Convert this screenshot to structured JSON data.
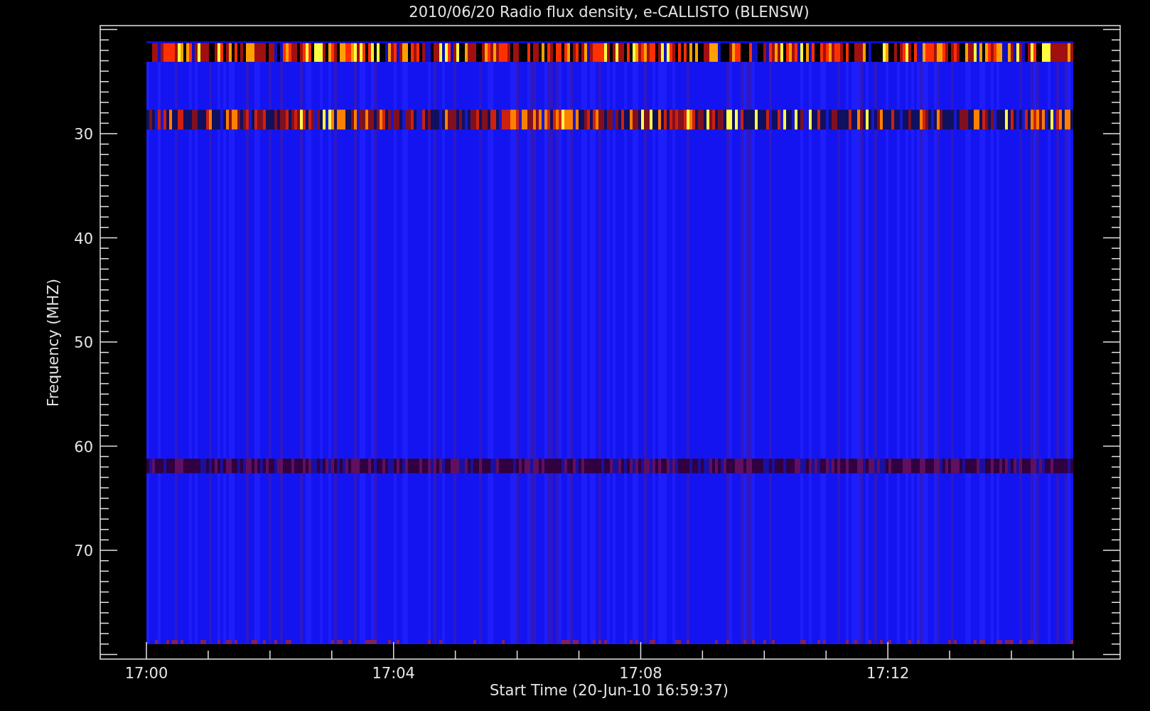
{
  "title": "2010/06/20  Radio flux density, e-CALLISTO (BLENSW)",
  "ylabel": "Frequency (MHZ)",
  "xlabel": "Start Time (20-Jun-10 16:59:37)",
  "yticks": [
    "30",
    "40",
    "50",
    "60",
    "70"
  ],
  "xticks": [
    "17:00",
    "17:04",
    "17:08",
    "17:12"
  ]
}
